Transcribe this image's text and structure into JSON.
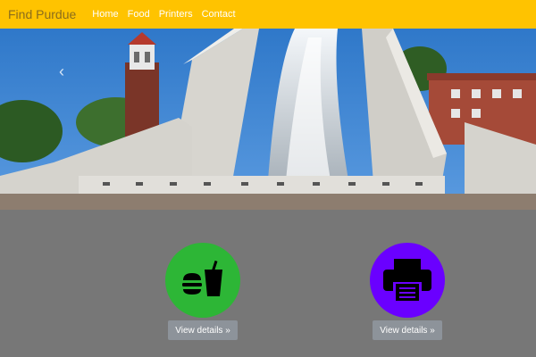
{
  "navbar": {
    "brand": "Find Purdue",
    "links": [
      "Home",
      "Food",
      "Printers",
      "Contact"
    ]
  },
  "carousel": {
    "prev_icon": "chevron-left-icon"
  },
  "features": [
    {
      "icon": "food-drink-icon",
      "color": "#2DB636",
      "button": "View details »"
    },
    {
      "icon": "printer-icon",
      "color": "#6A00FF",
      "button": "View details »"
    }
  ],
  "colors": {
    "navbar": "#FFC300",
    "content_bg": "#777777",
    "button_bg": "#8D939A"
  }
}
